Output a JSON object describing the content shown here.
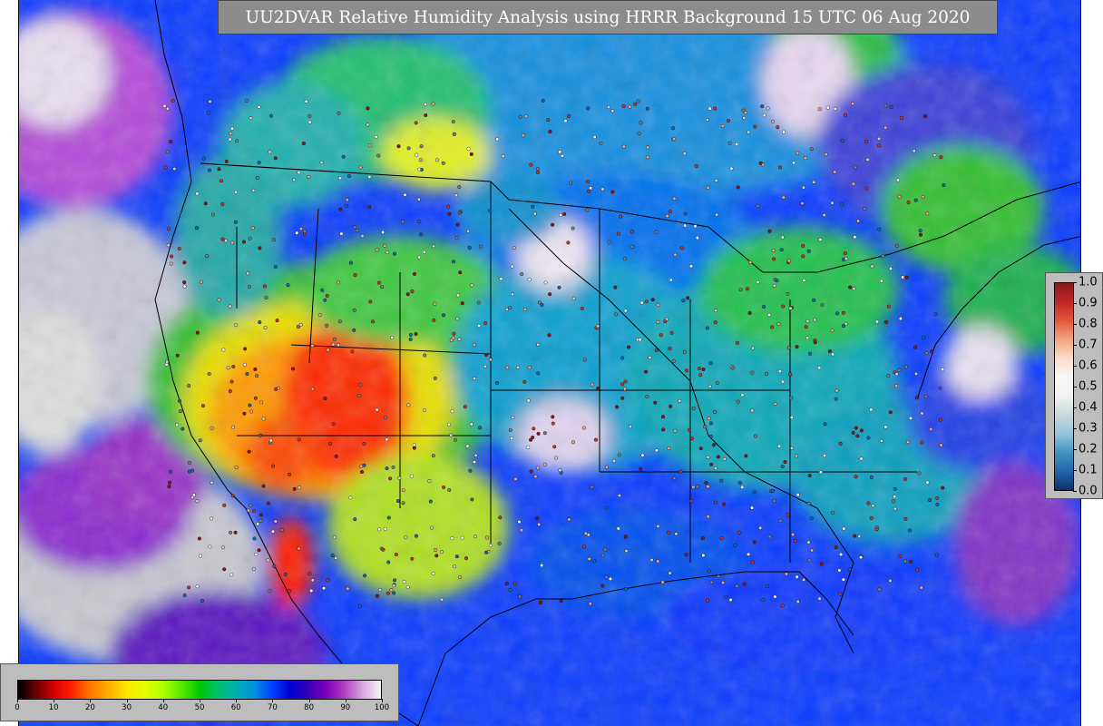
{
  "title": "UU2DVAR Relative Humidity Analysis using HRRR Background 15 UTC 06 Aug 2020",
  "rh_colorbar": {
    "ticks": [
      "0",
      "10",
      "20",
      "30",
      "40",
      "50",
      "60",
      "70",
      "80",
      "90",
      "100"
    ],
    "stops": [
      "#000000",
      "#6a0000",
      "#d60000",
      "#ff2400",
      "#ff7a00",
      "#ffb000",
      "#ffe600",
      "#e6ff00",
      "#aaff00",
      "#55e800",
      "#00c800",
      "#00c070",
      "#00b0b0",
      "#0090e0",
      "#0040ff",
      "#0000d0",
      "#3800b8",
      "#8000b8",
      "#b040c0",
      "#d8a8e0",
      "#f4f4f4"
    ]
  },
  "obs_colorbar": {
    "ticks": [
      "0.0",
      "0.1",
      "0.2",
      "0.3",
      "0.4",
      "0.5",
      "0.6",
      "0.7",
      "0.8",
      "0.9",
      "1.0"
    ],
    "stops": [
      "#08306b",
      "#2166ac",
      "#4393c3",
      "#92c5de",
      "#c7d9d9",
      "#f2f2f2",
      "#f7f7f7",
      "#fddbc7",
      "#f4a582",
      "#e05a3a",
      "#c0262a",
      "#8b1a1a"
    ]
  },
  "colors": {
    "background_ocean": "#0a3cff",
    "frame_gray": "#bdbdbd",
    "title_bg": "#8c8c8c"
  }
}
